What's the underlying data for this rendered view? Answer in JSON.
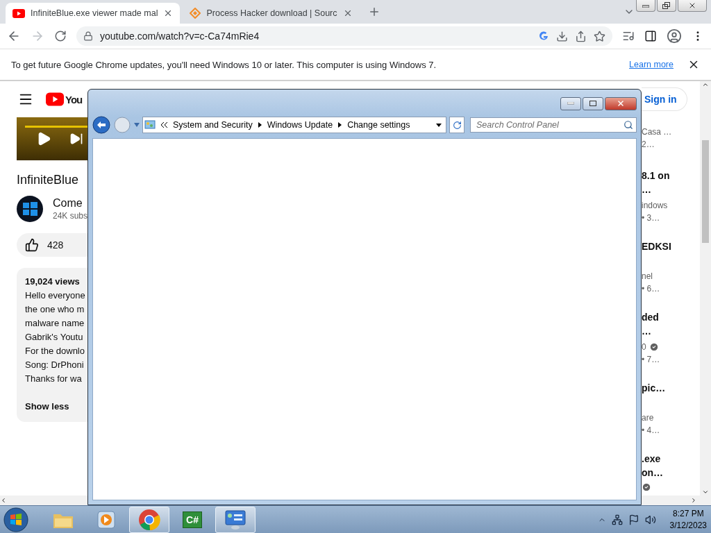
{
  "browser": {
    "tabs": [
      {
        "kind": "youtube",
        "title": "InfiniteBlue.exe viewer made mal",
        "selected": true
      },
      {
        "kind": "sourceforge",
        "title": "Process Hacker download | Sourc",
        "selected": false
      }
    ],
    "address": "youtube.com/watch?v=c-Ca74mRie4"
  },
  "infobar": {
    "message": "To get future Google Chrome updates, you'll need Windows 10 or later. This computer is using Windows 7.",
    "link": "Learn more"
  },
  "youtube": {
    "logo_text": "You",
    "sign_in": "Sign in",
    "video_title": "InfiniteBlue",
    "channel_name": "Come",
    "subscribers": "24K subs",
    "likes": "428",
    "views": "19,024 views",
    "description_lines": [
      "Hello everyone",
      "the one who m",
      "malware name",
      "Gabrik's Youtu",
      "For the downlo",
      "Song: DrPhoni",
      "Thanks for wa"
    ],
    "show_less": "Show less"
  },
  "recommendations": [
    {
      "meta_lines": [
        "Casa …",
        "2…"
      ],
      "verified": false
    },
    {
      "title_lines": [
        "8.1 on",
        "…"
      ],
      "meta_lines": [
        "indows",
        "• 3…"
      ],
      "verified": false
    },
    {
      "title_lines": [
        "EDKSI"
      ],
      "meta_lines": [
        "nel",
        "• 6…"
      ],
      "verified": false
    },
    {
      "title_lines": [
        "ded",
        "…"
      ],
      "meta_lines": [
        "0",
        "• 7…"
      ],
      "verified": true
    },
    {
      "title_lines": [
        "pic…"
      ],
      "meta_lines": [
        "are",
        "• 4…"
      ],
      "verified": false
    },
    {
      "title_lines": [
        ".exe",
        "on…"
      ],
      "verified": true
    }
  ],
  "control_panel": {
    "breadcrumb": [
      "System and Security",
      "Windows Update",
      "Change settings"
    ],
    "search": {
      "placeholder": "Search Control Panel"
    }
  },
  "taskbar": {
    "apps": [
      {
        "kind": "explorer",
        "active": false
      },
      {
        "kind": "media",
        "active": false
      },
      {
        "kind": "chrome",
        "active": true
      },
      {
        "kind": "csharp",
        "label": "C#",
        "active": false
      },
      {
        "kind": "controlpanel",
        "active": true
      }
    ],
    "time": "8:27 PM",
    "date": "3/12/2023"
  }
}
